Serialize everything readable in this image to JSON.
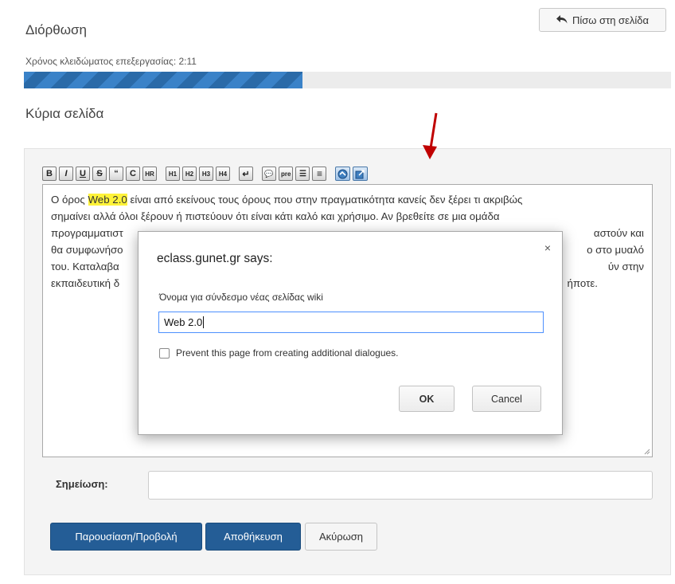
{
  "header": {
    "title": "Διόρθωση",
    "back_button_label": "Πίσω στη σελίδα",
    "back_icon": "reply-arrow-icon"
  },
  "lock": {
    "label": "Χρόνος κλειδώματος επεξεργασίας: 2:11",
    "progress_percent": 43
  },
  "section": {
    "title": "Κύρια σελίδα"
  },
  "toolbar": {
    "buttons": [
      {
        "label": "B",
        "icon": "bold-icon"
      },
      {
        "label": "I",
        "icon": "italic-icon"
      },
      {
        "label": "U",
        "icon": "underline-icon"
      },
      {
        "label": "S",
        "icon": "strikethrough-icon"
      },
      {
        "label": "“",
        "icon": "quote-icon"
      },
      {
        "label": "C",
        "icon": "code-icon"
      },
      {
        "label": "HR",
        "icon": "horizontal-rule-icon"
      },
      {
        "label": "H1",
        "icon": "heading1-icon"
      },
      {
        "label": "H2",
        "icon": "heading2-icon"
      },
      {
        "label": "H3",
        "icon": "heading3-icon"
      },
      {
        "label": "H4",
        "icon": "heading4-icon"
      },
      {
        "label": "↵",
        "icon": "line-break-icon"
      },
      {
        "label": "💬",
        "icon": "comment-icon"
      },
      {
        "label": "pre",
        "icon": "preformatted-icon"
      },
      {
        "label": "☰",
        "icon": "bullet-list-icon"
      },
      {
        "label": "≡",
        "icon": "numbered-list-icon"
      },
      {
        "label": "",
        "icon": "internal-link-icon"
      },
      {
        "label": "",
        "icon": "external-link-icon"
      }
    ]
  },
  "editor": {
    "text_before": "Ο όρος ",
    "highlighted": "Web 2.0",
    "line1_rest": " είναι από εκείνους τους όρους που στην πραγματικότητα κανείς δεν ξέρει τι ακριβώς",
    "line2": "σημαίνει αλλά όλοι ξέρουν ή πιστεύουν ότι είναι κάτι καλό και χρήσιμο. Αν βρεθείτε σε μια ομάδα",
    "line3_start": "προγραμματιστ",
    "line3_end": "αστούν και",
    "line4_start": "θα συμφωνήσο",
    "line4_end": "ο στο μυαλό",
    "line5_start": "του. Καταλαβα",
    "line5_end": "ύν στην",
    "line6_start": "εκπαιδευτική δ",
    "line6_end": "ήποτε."
  },
  "note": {
    "label": "Σημείωση:",
    "value": ""
  },
  "actions": {
    "preview": "Παρουσίαση/Προβολή",
    "save": "Αποθήκευση",
    "cancel": "Ακύρωση"
  },
  "dialog": {
    "title": "eclass.gunet.gr says:",
    "close_symbol": "×",
    "message": "Όνομα για σύνδεσμο νέας σελίδας wiki",
    "input_value": "Web 2.0",
    "checkbox_label": "Prevent this page from creating additional dialogues.",
    "checkbox_checked": false,
    "ok": "OK",
    "cancel": "Cancel"
  },
  "colors": {
    "primary_button": "#245d96",
    "progress": "#3a82c8",
    "highlight": "#fff33a",
    "annotation_arrow": "#c00000"
  }
}
